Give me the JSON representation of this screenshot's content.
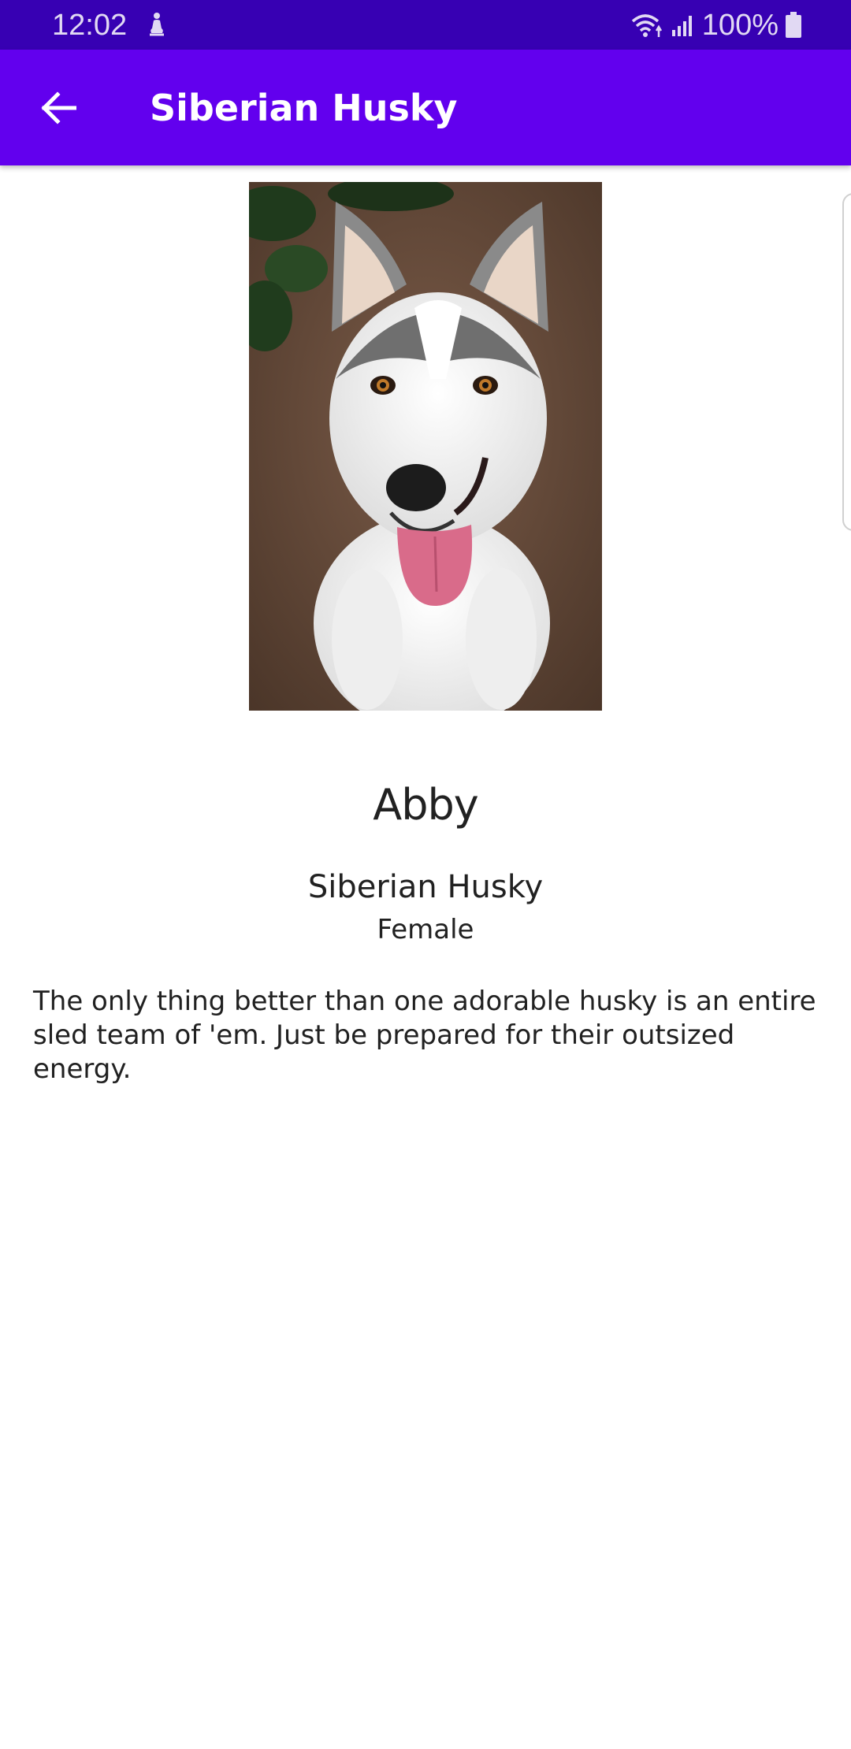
{
  "status_bar": {
    "time": "12:02",
    "battery": "100%"
  },
  "app_bar": {
    "title": "Siberian Husky",
    "back_icon": "arrow-back-icon"
  },
  "pet": {
    "photo_icon": "husky-photo",
    "name": "Abby",
    "breed": "Siberian Husky",
    "gender": "Female",
    "description": "The only thing better than one adorable husky is an entire sled team of 'em. Just be prepared for their outsized energy."
  },
  "colors": {
    "status_bar": "#3700b3",
    "app_bar": "#6200ee",
    "text": "#212121"
  }
}
